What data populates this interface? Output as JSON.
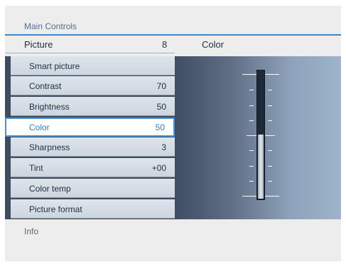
{
  "panel": {
    "title": "Main Controls",
    "header": {
      "label": "Picture",
      "value": "8",
      "right_label": "Color"
    }
  },
  "menu": {
    "items": [
      {
        "label": "Smart picture",
        "value": ""
      },
      {
        "label": "Contrast",
        "value": "70"
      },
      {
        "label": "Brightness",
        "value": "50"
      },
      {
        "label": "Color",
        "value": "50",
        "selected": true
      },
      {
        "label": "Sharpness",
        "value": "3"
      },
      {
        "label": "Tint",
        "value": "+00"
      },
      {
        "label": "Color temp",
        "value": ""
      },
      {
        "label": "Picture format",
        "value": ""
      }
    ]
  },
  "slider": {
    "label": "Color",
    "level_percent": 50,
    "fill_color": "#e6ebef",
    "track_color": "#1d2a38"
  },
  "footer": {
    "info": "Info"
  },
  "colors": {
    "accent": "#4b90d1",
    "selected_text": "#2f7fc7",
    "panel_bg": "#ededed"
  }
}
